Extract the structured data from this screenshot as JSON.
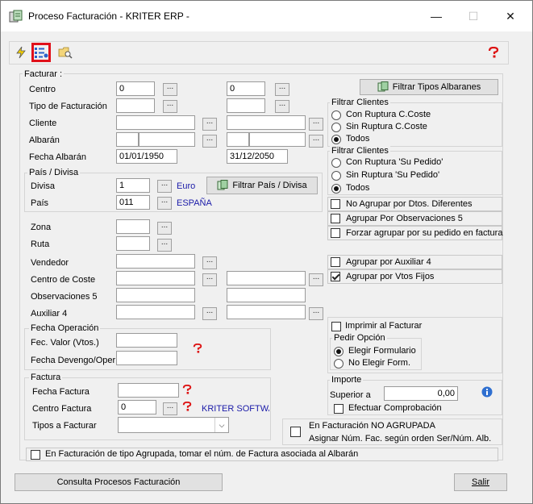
{
  "window": {
    "title": "Proceso Facturación - KRITER ERP -",
    "controls": {
      "minimize": "—",
      "maximize": "☐",
      "close": "✕"
    }
  },
  "toolbar": {
    "icons": [
      "lightning-icon",
      "list-settings-icon",
      "folder-search-icon",
      "help-icon"
    ]
  },
  "facturar": {
    "title": "Facturar :",
    "labels": {
      "centro": "Centro",
      "tipo_facturacion": "Tipo de Facturación",
      "cliente": "Cliente",
      "albaran": "Albarán",
      "fecha_albaran": "Fecha Albarán"
    },
    "centro_from": "0",
    "centro_to": "0",
    "fecha_albaran_from": "01/01/1950",
    "fecha_albaran_to": "31/12/2050",
    "dots": "..."
  },
  "pais_divisa": {
    "title": "País / Divisa",
    "divisa_label": "Divisa",
    "divisa_value": "1",
    "divisa_name": "Euro",
    "pais_label": "País",
    "pais_value": "011",
    "pais_name": "ESPAÑA",
    "filter_button": "Filtrar País / Divisa"
  },
  "filters": {
    "zona": "Zona",
    "ruta": "Ruta",
    "vendedor": "Vendedor",
    "centro_coste": "Centro de Coste",
    "observaciones5": "Observaciones 5",
    "auxiliar4": "Auxiliar 4"
  },
  "fecha_operacion": {
    "title": "Fecha Operación",
    "fec_valor": "Fec. Valor (Vtos.)",
    "fecha_devengo": "Fecha Devengo/Oper"
  },
  "factura": {
    "title": "Factura",
    "fecha_factura": "Fecha Factura",
    "centro_factura": "Centro Factura",
    "centro_factura_value": "0",
    "centro_factura_name": "KRITER SOFTWA",
    "tipos_facturar": "Tipos a Facturar"
  },
  "right": {
    "filtrar_tipos_button": "Filtrar Tipos Albaranes",
    "filtrar_clientes_1": {
      "title": "Filtrar Clientes",
      "options": [
        "Con Ruptura C.Coste",
        "Sin Ruptura C.Coste",
        "Todos"
      ],
      "selected": 2
    },
    "filtrar_clientes_2": {
      "title": "Filtrar Clientes",
      "options": [
        "Con Ruptura 'Su Pedido'",
        "Sin Ruptura 'Su Pedido'",
        "Todos"
      ],
      "selected": 2
    },
    "checks_a": [
      {
        "label": "No Agrupar por Dtos. Diferentes",
        "checked": false
      },
      {
        "label": "Agrupar Por Observaciones 5",
        "checked": false
      },
      {
        "label": "Forzar agrupar por su pedido en factura",
        "checked": false
      }
    ],
    "checks_b": [
      {
        "label": "Agrupar por Auxiliar 4",
        "checked": false
      },
      {
        "label": "Agrupar por Vtos Fijos",
        "checked": true
      }
    ],
    "imprimir": {
      "label": "Imprimir al Facturar",
      "checked": false
    },
    "pedir_opcion": {
      "title": "Pedir Opción",
      "options": [
        "Elegir Formulario",
        "No Elegir Form."
      ],
      "selected": 0
    },
    "importe": {
      "title": "Importe",
      "superior_label": "Superior a",
      "superior_value": "0,00",
      "efectuar_label": "Efectuar Comprobación",
      "efectuar_checked": false
    },
    "no_agrupada": {
      "line1": "En Facturación NO AGRUPADA",
      "line2": "Asignar Núm. Fac. según orden Ser/Núm. Alb.",
      "checked": false
    }
  },
  "bottom_check": {
    "label": "En Facturación de tipo Agrupada, tomar el núm. de Factura asociada al Albarán",
    "checked": false
  },
  "footer": {
    "consulta_button": "Consulta Procesos Facturación",
    "salir_button": "Salir"
  }
}
